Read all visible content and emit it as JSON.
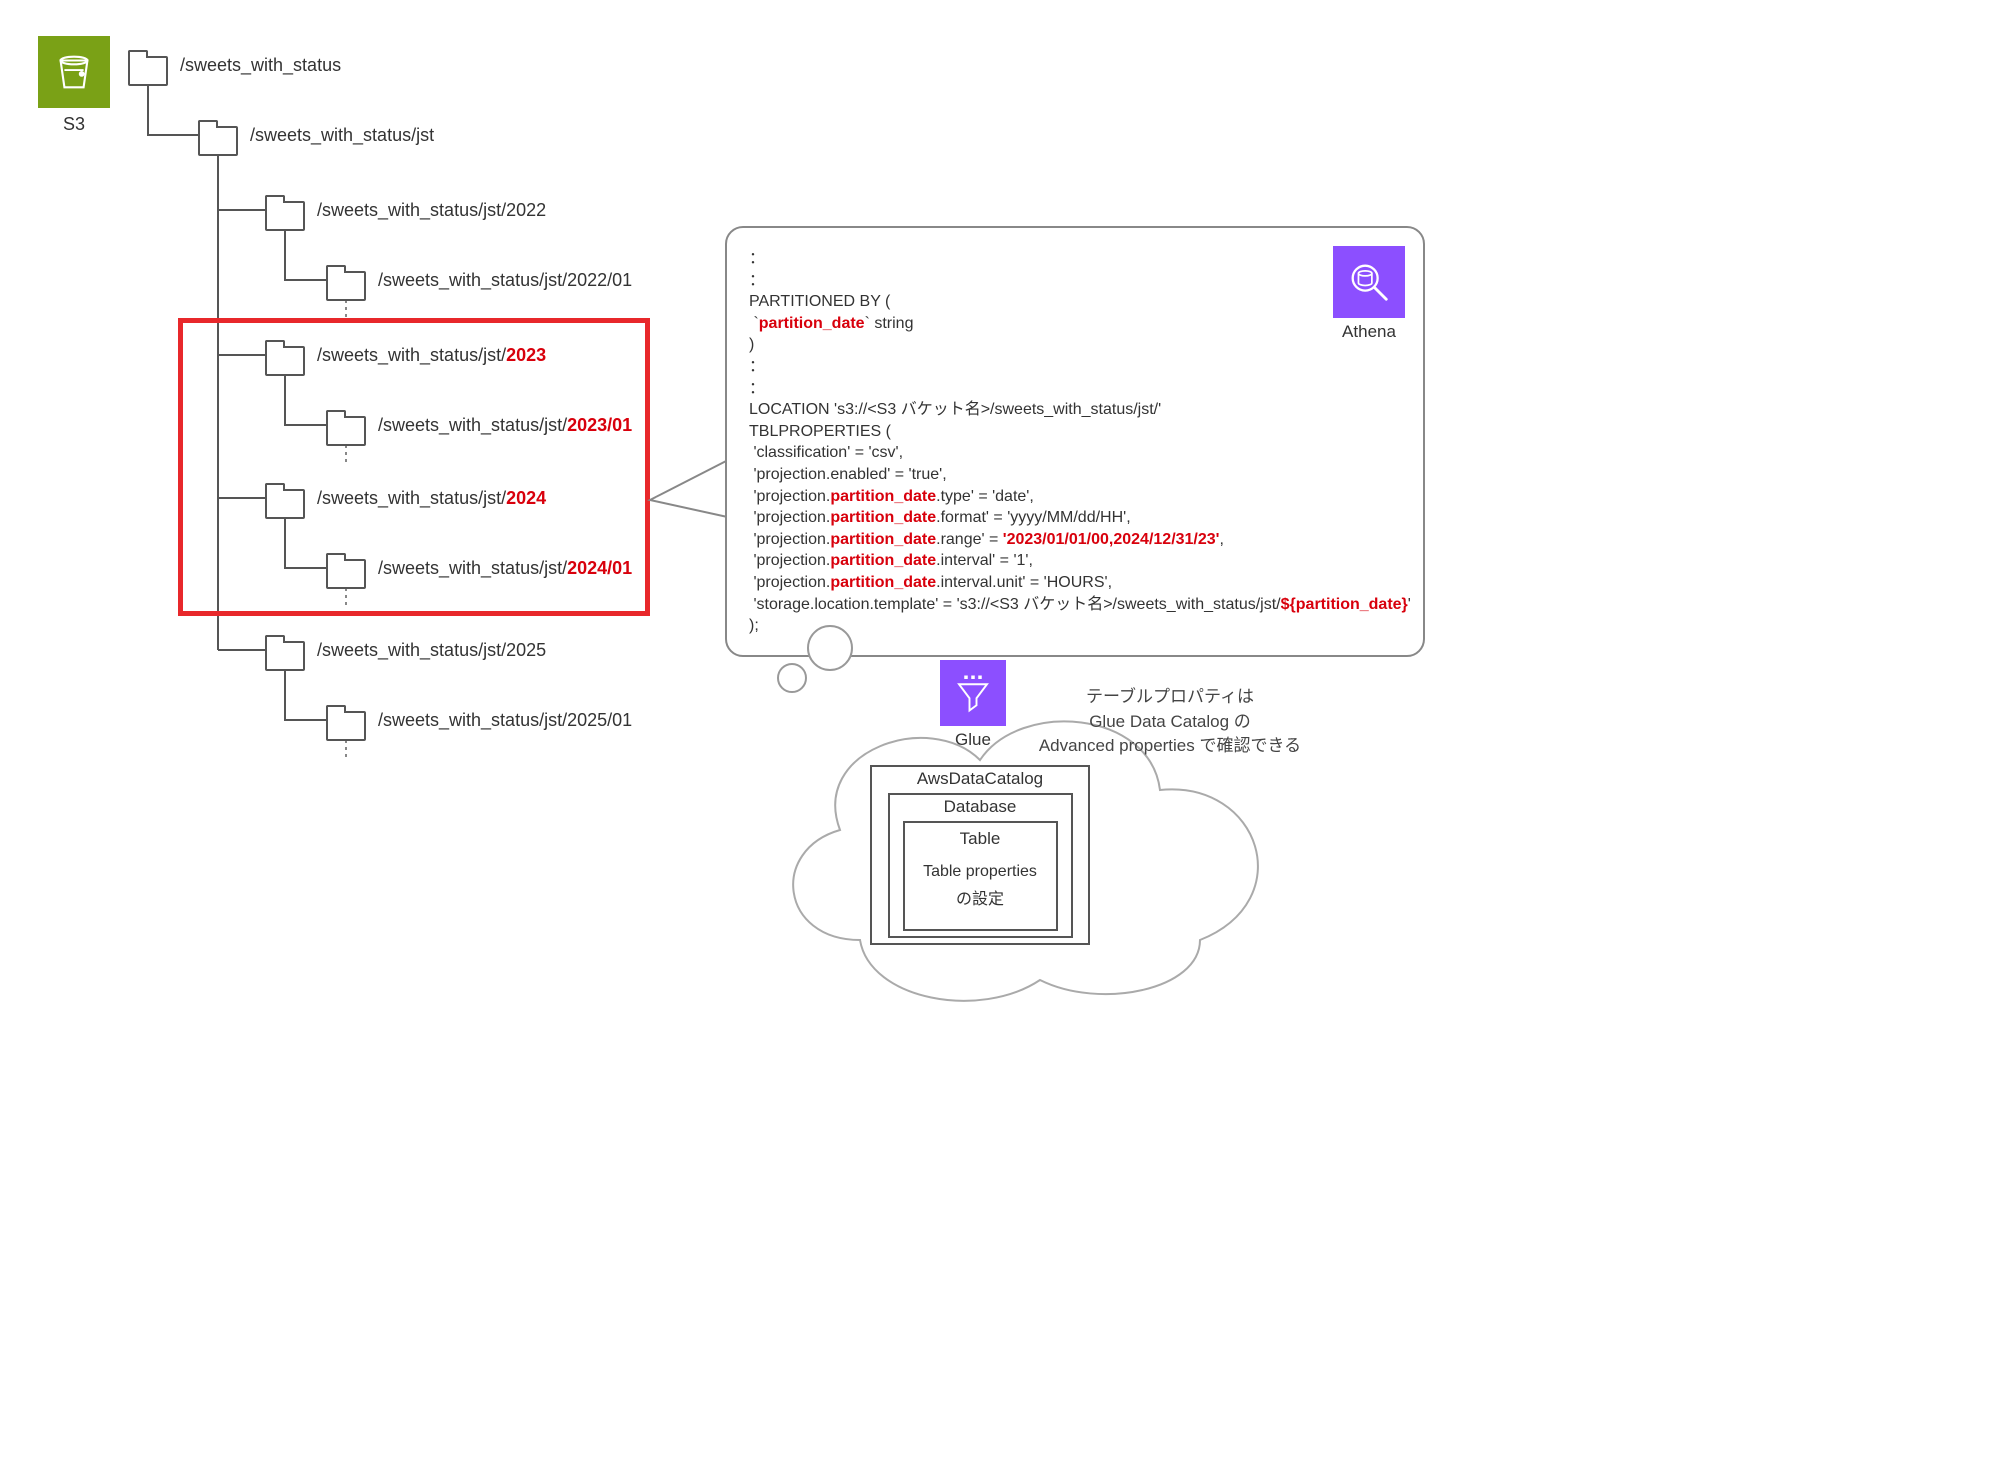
{
  "s3": {
    "label": "S3"
  },
  "folders": {
    "root": "/sweets_with_status",
    "jst": "/sweets_with_status/jst",
    "y2022": "/sweets_with_status/jst/2022",
    "y2022m01": "/sweets_with_status/jst/2022/01",
    "y2023_prefix": "/sweets_with_status/jst/",
    "y2023": "2023",
    "y2023m01_prefix": "/sweets_with_status/jst/",
    "y2023m01": "2023/01",
    "y2024_prefix": "/sweets_with_status/jst/",
    "y2024": "2024",
    "y2024m01_prefix": "/sweets_with_status/jst/",
    "y2024m01": "2024/01",
    "y2025": "/sweets_with_status/jst/2025",
    "y2025m01": "/sweets_with_status/jst/2025/01"
  },
  "athena": {
    "label": "Athena"
  },
  "code": {
    "l1": "：",
    "l2": "：",
    "l3": "PARTITIONED BY (",
    "l4a": " `",
    "l4b": "partition_date",
    "l4c": "` string",
    "l5": ")",
    "l6": "：",
    "l7": "：",
    "l8": "LOCATION 's3://<S3 バケット名>/sweets_with_status/jst/'",
    "l9": "TBLPROPERTIES (",
    "l10": " 'classification' = 'csv',",
    "l11": " 'projection.enabled' = 'true',",
    "l12a": " 'projection.",
    "l12b": "partition_date",
    "l12c": ".type' = 'date',",
    "l13a": " 'projection.",
    "l13b": "partition_date",
    "l13c": ".format' = 'yyyy/MM/dd/HH',",
    "l14a": " 'projection.",
    "l14b": "partition_date",
    "l14c": ".range' = ",
    "l14d": "'2023/01/01/00,2024/12/31/23'",
    "l14e": ",",
    "l15a": " 'projection.",
    "l15b": "partition_date",
    "l15c": ".interval' = '1',",
    "l16a": " 'projection.",
    "l16b": "partition_date",
    "l16c": ".interval.unit' = 'HOURS',",
    "l17a": " 'storage.location.template' = 's3://<S3 バケット名>/sweets_with_status/jst/",
    "l17b": "${partition_date}",
    "l17c": "'",
    "l18": ");"
  },
  "glue": {
    "label": "Glue",
    "catalog": "AwsDataCatalog",
    "database": "Database",
    "table": "Table",
    "tableprops1": "Table properties",
    "tableprops2": "の設定",
    "note1": "テーブルプロパティは",
    "note2": "Glue Data Catalog の",
    "note3": "Advanced properties で確認できる"
  }
}
